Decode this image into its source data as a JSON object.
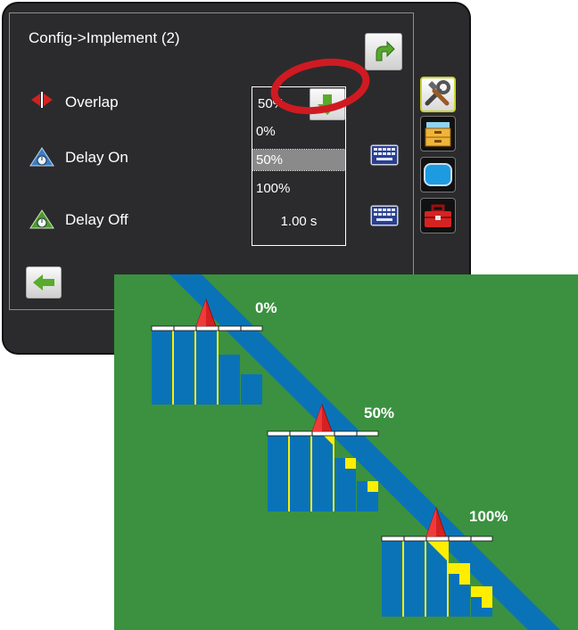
{
  "panel": {
    "title": "Config->Implement (2)"
  },
  "rows": {
    "overlap": {
      "label": "Overlap",
      "value": "50%"
    },
    "delay_on": {
      "label": "Delay On"
    },
    "delay_off": {
      "label": "Delay Off",
      "value": "1.00 s"
    }
  },
  "dropdown": {
    "options": [
      "0%",
      "50%",
      "100%"
    ],
    "selected_index": 1
  },
  "sidebar": {
    "items": [
      {
        "icon": "tools-icon",
        "active": true
      },
      {
        "icon": "file-cabinet-icon",
        "active": false
      },
      {
        "icon": "display-icon",
        "active": false
      },
      {
        "icon": "toolbox-icon",
        "active": false
      }
    ]
  },
  "diagram": {
    "labels": [
      "0%",
      "50%",
      "100%"
    ]
  },
  "colors": {
    "field_green": "#3b9140",
    "swath_blue": "#0a73b8",
    "overlap_yellow": "#ffee00",
    "vehicle_red": "#d42020",
    "button_green": "#5aaa2d",
    "annotation_red": "#d01a22"
  }
}
